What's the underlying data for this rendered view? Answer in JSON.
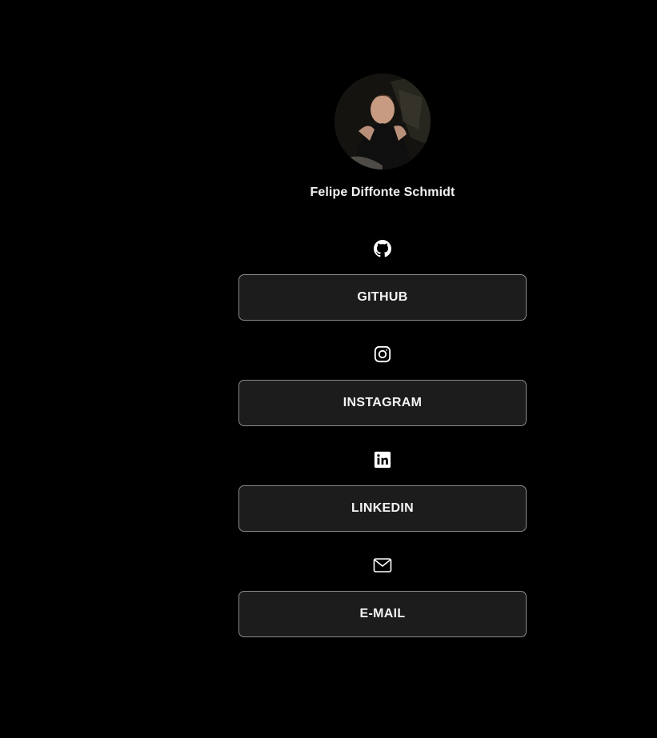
{
  "profile": {
    "name": "Felipe Diffonte Schmidt",
    "avatar_icon": "profile-photo"
  },
  "links": [
    {
      "icon": "github-icon",
      "label": "GITHUB"
    },
    {
      "icon": "instagram-icon",
      "label": "INSTAGRAM"
    },
    {
      "icon": "linkedin-icon",
      "label": "LINKEDIN"
    },
    {
      "icon": "mail-icon",
      "label": "E-MAIL"
    }
  ],
  "colors": {
    "background": "#000000",
    "button_bg": "#1c1c1c",
    "button_border": "#8a8a8a",
    "text": "#ffffff"
  }
}
